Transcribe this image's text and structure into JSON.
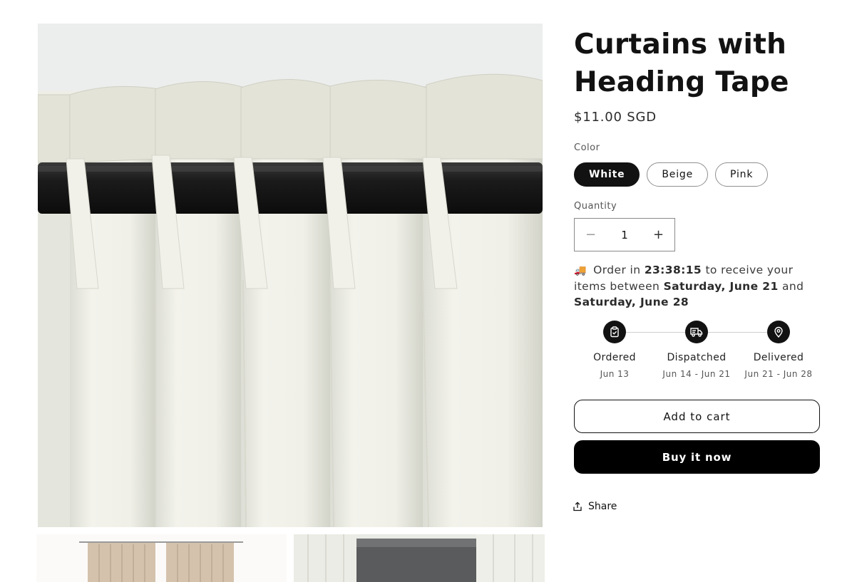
{
  "product": {
    "title": "Curtains with Heading Tape",
    "price": "$11.00 SGD"
  },
  "color": {
    "label": "Color",
    "options": [
      "White",
      "Beige",
      "Pink"
    ],
    "selected": "White"
  },
  "quantity": {
    "label": "Quantity",
    "value": "1",
    "decrease_symbol": "−",
    "increase_symbol": "+"
  },
  "delivery": {
    "emoji": "🚚",
    "prefix": "Order in",
    "countdown": "23:38:15",
    "middle": "to receive your items between",
    "start_date": "Saturday, June 21",
    "conjunction": "and",
    "end_date": "Saturday, June 28"
  },
  "timeline": [
    {
      "label": "Ordered",
      "date": "Jun 13",
      "icon": "clipboard-check-icon"
    },
    {
      "label": "Dispatched",
      "date": "Jun 14 - Jun 21",
      "icon": "truck-icon"
    },
    {
      "label": "Delivered",
      "date": "Jun 21 - Jun 28",
      "icon": "map-pin-icon"
    }
  ],
  "actions": {
    "add_to_cart": "Add to cart",
    "buy_now": "Buy it now",
    "share": "Share"
  },
  "colors": {
    "primary": "#121212",
    "buy_button": "#000000",
    "curtain_white": "#eeeee6",
    "curtain_beige": "#d4c2ad"
  }
}
